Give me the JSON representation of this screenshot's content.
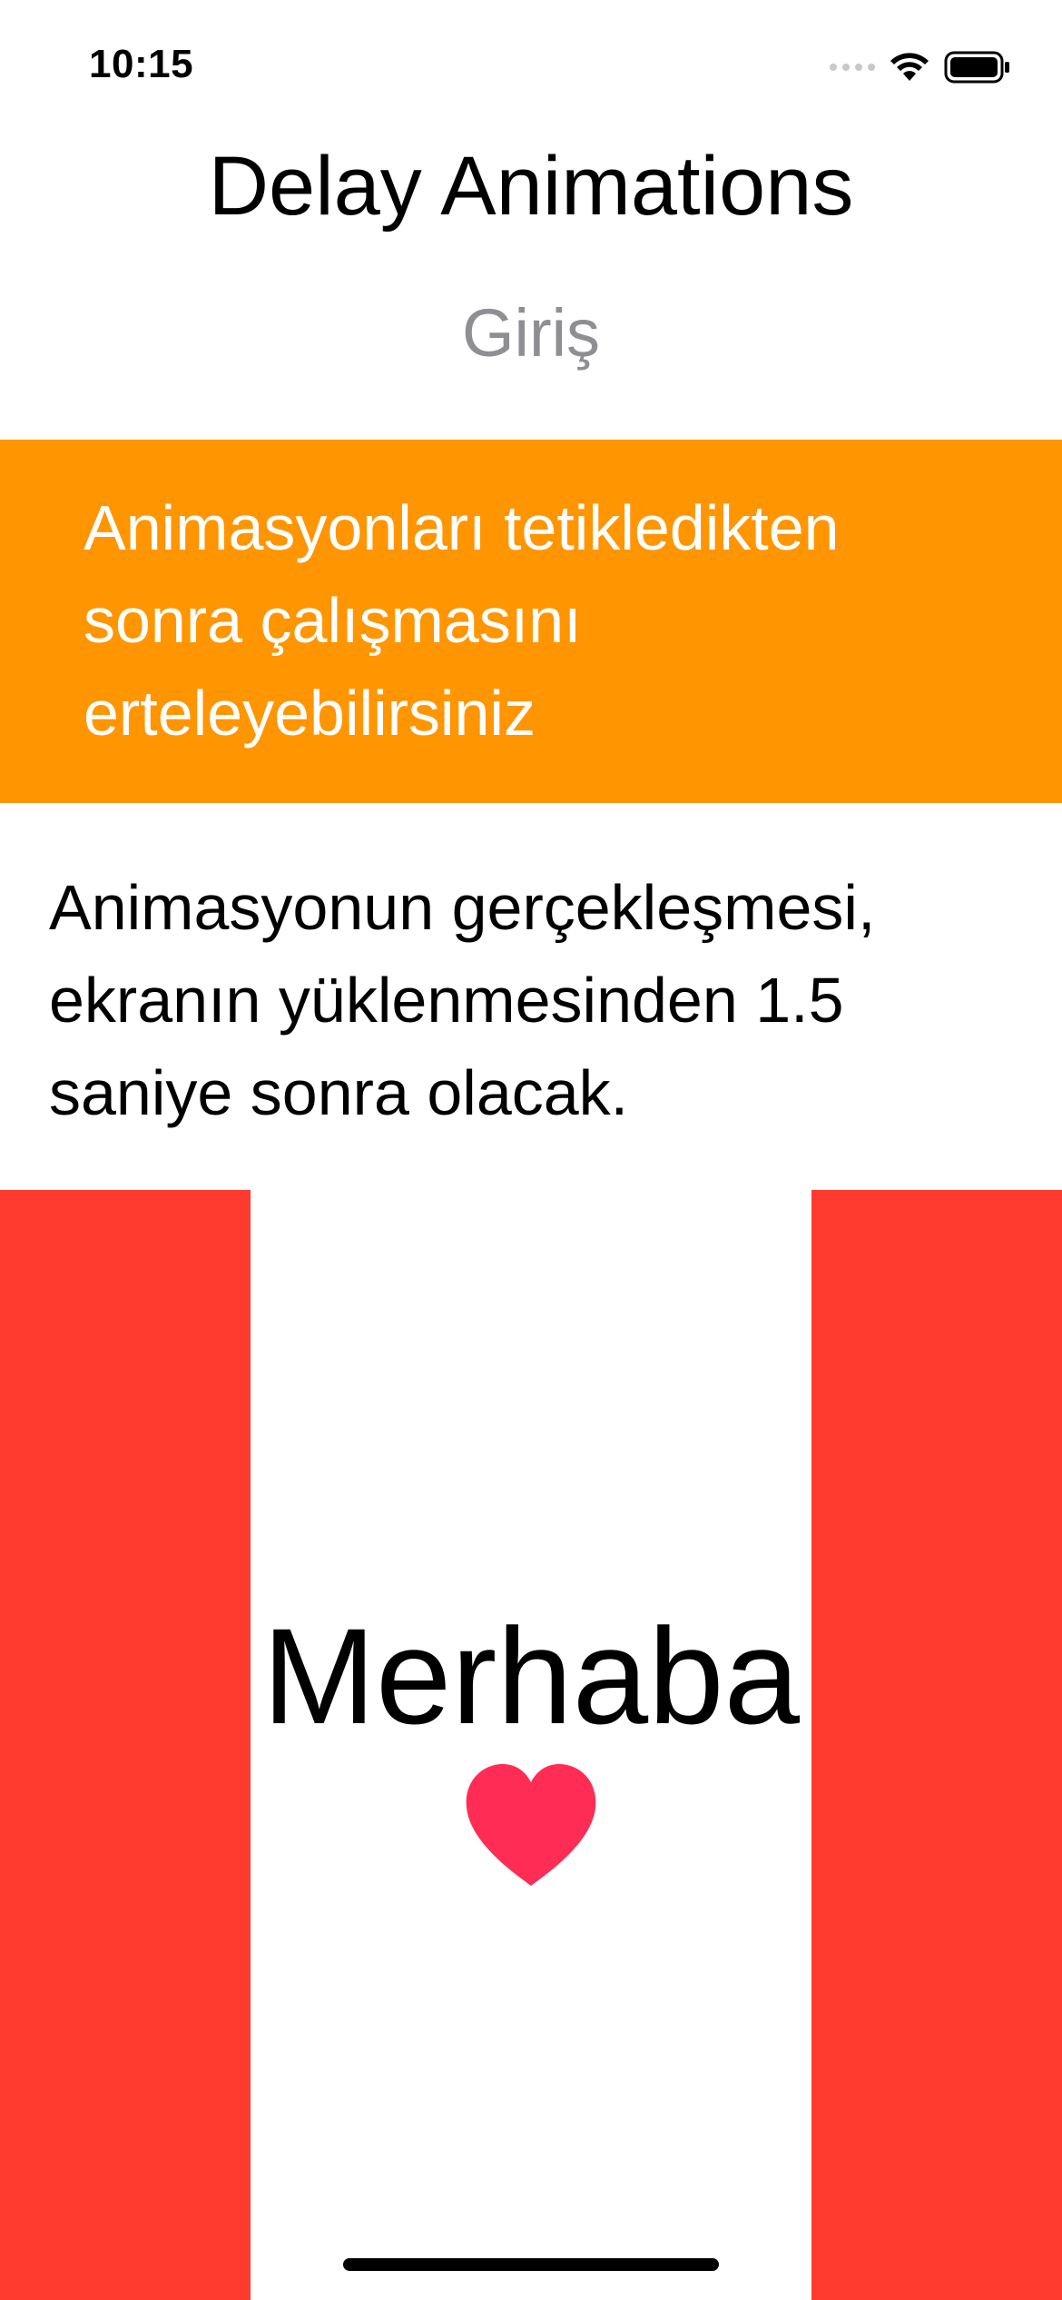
{
  "status_bar": {
    "time": "10:15",
    "icons": [
      "cellular-signal-icon",
      "wifi-icon",
      "battery-icon"
    ]
  },
  "header": {
    "title": "Delay Animations",
    "subtitle": "Giriş"
  },
  "banner": {
    "text": "Animasyonları tetikledikten sonra çalışmasını erteleyebilirsiniz",
    "background_color": "#ff9500"
  },
  "description": {
    "text": "Animasyonun gerçekleşmesi, ekranın yüklenmesinden 1.5 saniye sonra olacak."
  },
  "demo": {
    "greeting": "Merhaba",
    "icon": "heart-icon",
    "side_color": "#ff3b30",
    "heart_color": "#ff2d55"
  }
}
